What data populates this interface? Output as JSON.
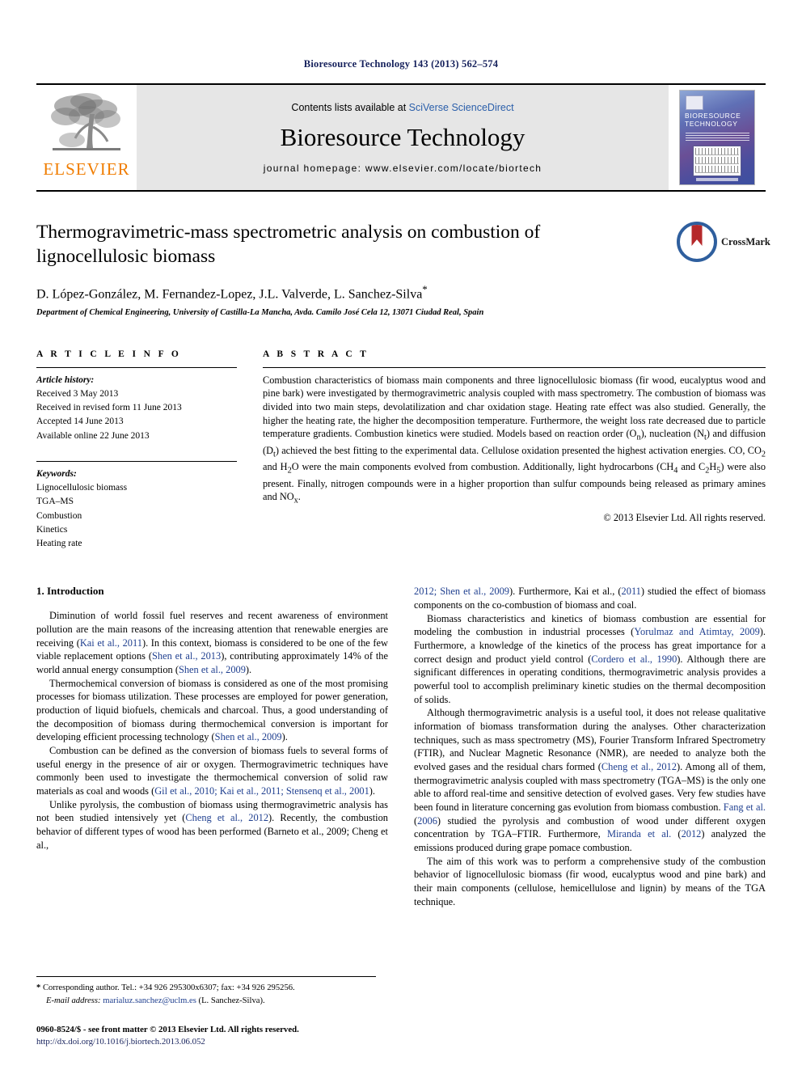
{
  "running_head": "Bioresource Technology 143 (2013) 562–574",
  "masthead": {
    "publisher_name": "ELSEVIER",
    "contents_prefix": "Contents lists available at ",
    "contents_link": "SciVerse ScienceDirect",
    "journal_title": "Bioresource Technology",
    "homepage": "journal homepage: www.elsevier.com/locate/biortech",
    "cover_title": "BIORESOURCE TECHNOLOGY"
  },
  "article": {
    "title": "Thermogravimetric-mass spectrometric analysis on combustion of lignocellulosic biomass",
    "authors": "D. López-González, M. Fernandez-Lopez, J.L. Valverde, L. Sanchez-Silva",
    "corresponding_marker": "*",
    "affiliation": "Department of Chemical Engineering, University of Castilla-La Mancha, Avda. Camilo José Cela 12, 13071 Ciudad Real, Spain",
    "crossmark_label": "CrossMark"
  },
  "article_info": {
    "heading": "A R T I C L E   I N F O",
    "history_label": "Article history:",
    "history": [
      "Received 3 May 2013",
      "Received in revised form 11 June 2013",
      "Accepted 14 June 2013",
      "Available online 22 June 2013"
    ],
    "keywords_label": "Keywords:",
    "keywords": [
      "Lignocellulosic biomass",
      "TGA–MS",
      "Combustion",
      "Kinetics",
      "Heating rate"
    ]
  },
  "abstract": {
    "heading": "A B S T R A C T",
    "text": "Combustion characteristics of biomass main components and three lignocellulosic biomass (fir wood, eucalyptus wood and pine bark) were investigated by thermogravimetric analysis coupled with mass spectrometry. The combustion of biomass was divided into two main steps, devolatilization and char oxidation stage. Heating rate effect was also studied. Generally, the higher the heating rate, the higher the decomposition temperature. Furthermore, the weight loss rate decreased due to particle temperature gradients. Combustion kinetics were studied. Models based on reaction order (On), nucleation (Nt) and diffusion (Dt) achieved the best fitting to the experimental data. Cellulose oxidation presented the highest activation energies. CO, CO2 and H2O were the main components evolved from combustion. Additionally, light hydrocarbons (CH4 and C2H5) were also present. Finally, nitrogen compounds were in a higher proportion than sulfur compounds being released as primary amines and NOx.",
    "copyright": "© 2013 Elsevier Ltd. All rights reserved."
  },
  "introduction": {
    "heading": "1. Introduction",
    "left_paragraphs": [
      "Diminution of world fossil fuel reserves and recent awareness of environment pollution are the main reasons of the increasing attention that renewable energies are receiving (Kai et al., 2011). In this context, biomass is considered to be one of the few viable replacement options (Shen et al., 2013), contributing approximately 14% of the world annual energy consumption (Shen et al., 2009).",
      "Thermochemical conversion of biomass is considered as one of the most promising processes for biomass utilization. These processes are employed for power generation, production of liquid biofuels, chemicals and charcoal. Thus, a good understanding of the decomposition of biomass during thermochemical conversion is important for developing efficient processing technology (Shen et al., 2009).",
      "Combustion can be defined as the conversion of biomass fuels to several forms of useful energy in the presence of air or oxygen. Thermogravimetric techniques have commonly been used to investigate the thermochemical conversion of solid raw materials as coal and woods (Gil et al., 2010; Kai et al., 2011; Stensenq et al., 2001).",
      "Unlike pyrolysis, the combustion of biomass using thermogravimetric analysis has not been studied intensively yet (Cheng et al., 2012). Recently, the combustion behavior of different types of wood has been performed (Barneto et al., 2009; Cheng et al.,"
    ],
    "right_paragraphs": [
      "2012; Shen et al., 2009). Furthermore, Kai et al., (2011) studied the effect of biomass components on the co-combustion of biomass and coal.",
      "Biomass characteristics and kinetics of biomass combustion are essential for modeling the combustion in industrial processes (Yorulmaz and Atimtay, 2009). Furthermore, a knowledge of the kinetics of the process has great importance for a correct design and product yield control (Cordero et al., 1990). Although there are significant differences in operating conditions, thermogravimetric analysis provides a powerful tool to accomplish preliminary kinetic studies on the thermal decomposition of solids.",
      "Although thermogravimetric analysis is a useful tool, it does not release qualitative information of biomass transformation during the analyses. Other characterization techniques, such as mass spectrometry (MS), Fourier Transform Infrared Spectrometry (FTIR), and Nuclear Magnetic Resonance (NMR), are needed to analyze both the evolved gases and the residual chars formed (Cheng et al., 2012). Among all of them, thermogravimetric analysis coupled with mass spectrometry (TGA–MS) is the only one able to afford real-time and sensitive detection of evolved gases. Very few studies have been found in literature concerning gas evolution from biomass combustion. Fang et al. (2006) studied the pyrolysis and combustion of wood under different oxygen concentration by TGA–FTIR. Furthermore, Miranda et al. (2012) analyzed the emissions produced during grape pomace combustion.",
      "The aim of this work was to perform a comprehensive study of the combustion behavior of lignocellulosic biomass (fir wood, eucalyptus wood and pine bark) and their main components (cellulose, hemicellulose and lignin) by means of the TGA technique."
    ]
  },
  "footnote": {
    "marker": "*",
    "line1": "Corresponding author. Tel.: +34 926 295300x6307; fax: +34 926 295256.",
    "email_label": "E-mail address:",
    "email": "marialuz.sanchez@uclm.es",
    "email_suffix": "(L. Sanchez-Silva)."
  },
  "footer": {
    "issn_line": "0960-8524/$ - see front matter © 2013 Elsevier Ltd. All rights reserved.",
    "doi": "http://dx.doi.org/10.1016/j.biortech.2013.06.052"
  }
}
